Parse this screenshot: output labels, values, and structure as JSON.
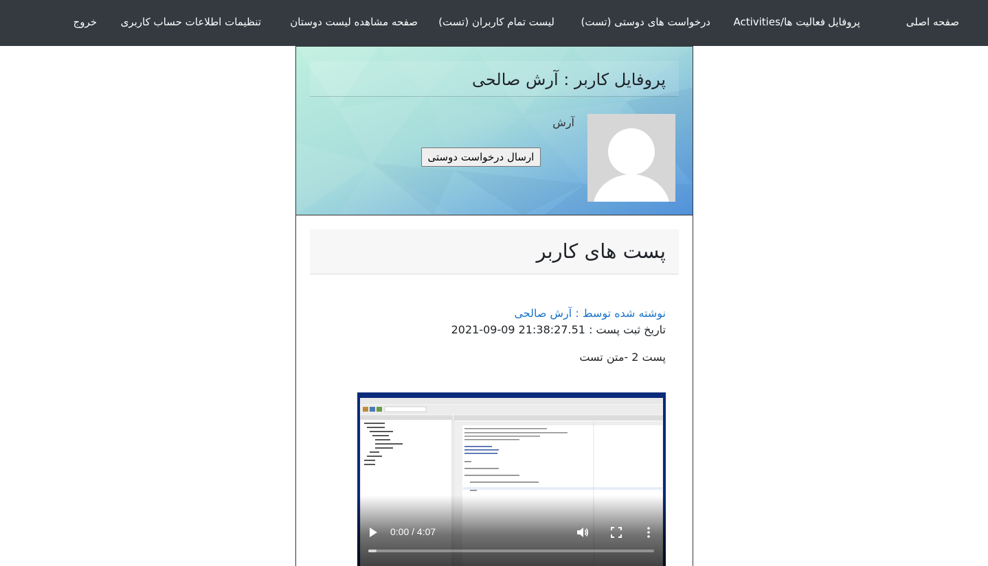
{
  "nav": {
    "home": "صفحه اصلی",
    "profile": "پروفایل",
    "activities": "فعالیت ها/Activities",
    "friend_requests": "درخواست های دوستی (تست)",
    "all_users": "لیست تمام کاربران (تست)",
    "friends_list": "صفحه مشاهده لیست دوستان",
    "account_settings": "تنظیمات اطلاعات حساب کاربری",
    "logout": "خروج"
  },
  "profile": {
    "title": "پروفایل کاربر : آرش صالحی",
    "first_name": "آرش",
    "friend_request_button": "ارسال درخواست دوستی",
    "avatar_icon": "default-user-avatar-icon"
  },
  "posts": {
    "section_title": "پست های کاربر",
    "items": [
      {
        "author": "نوشته شده توسط : آرش صالحی",
        "date_label": "تاریخ ثبت پست :",
        "date_value": "2021-09-09 21:38:27.51",
        "text": "پست 2 -متن تست",
        "video": {
          "time": "0:00 / 4:07",
          "progress": 0.03,
          "icons": [
            "play-icon",
            "volume-icon",
            "fullscreen-icon",
            "more-options-icon"
          ]
        }
      }
    ]
  },
  "colors": {
    "navbar": "#343a40",
    "link": "#1a73c8",
    "profile_bg_start": "#b9ecdc",
    "profile_bg_end": "#5b9be0"
  }
}
